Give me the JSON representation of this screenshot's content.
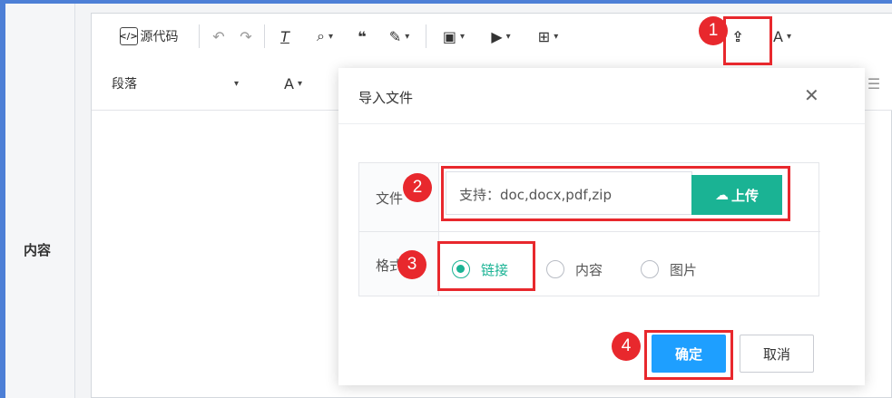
{
  "form_label": "内容",
  "toolbar": {
    "source_label": "源代码",
    "paragraph_label": "段落",
    "icons": [
      "undo-icon",
      "redo-icon",
      "clear-format-icon",
      "find-replace-icon",
      "quote-icon",
      "highlight-icon",
      "image-icon",
      "media-icon",
      "table-icon",
      "import-file-icon",
      "spellcheck-icon"
    ]
  },
  "modal": {
    "title": "导入文件",
    "file_label": "文件",
    "format_label": "格式",
    "file_placeholder": "支持：doc,docx,pdf,zip",
    "upload_label": "上传",
    "radio_options": [
      {
        "label": "链接",
        "selected": true
      },
      {
        "label": "内容",
        "selected": false
      },
      {
        "label": "图片",
        "selected": false
      }
    ],
    "ok_label": "确定",
    "cancel_label": "取消"
  },
  "callouts": [
    "1",
    "2",
    "3",
    "4"
  ],
  "colors": {
    "accent_green": "#1ab394",
    "primary_blue": "#1e9fff",
    "callout_red": "#e8282d",
    "frame_blue": "#4d7fd6"
  }
}
